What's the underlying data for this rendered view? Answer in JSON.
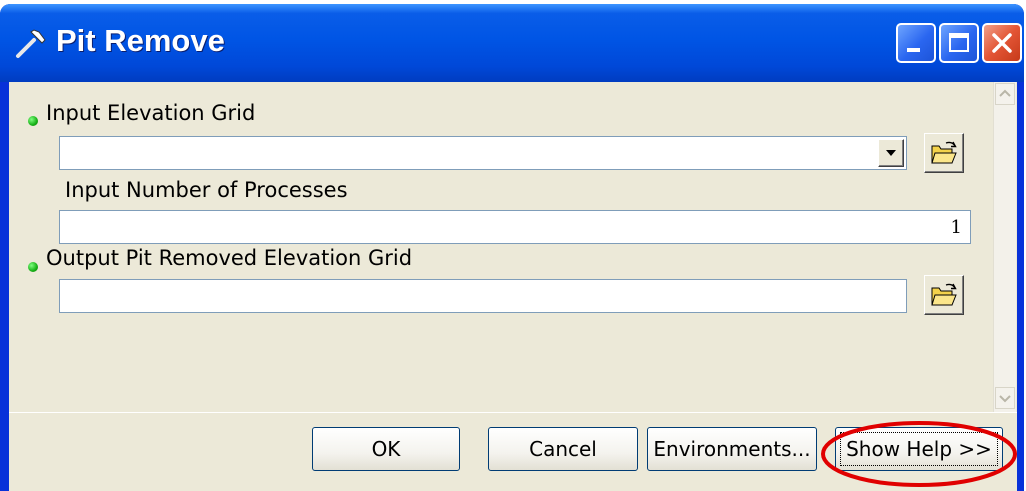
{
  "window": {
    "title": "Pit Remove",
    "icon": "hammer-icon",
    "controls": [
      "minimize-icon",
      "maximize-icon",
      "close-icon"
    ]
  },
  "form": {
    "input_elevation_grid": {
      "label": "Input Elevation Grid",
      "value": "",
      "required": true
    },
    "input_number_of_processes": {
      "label": "Input Number of Processes",
      "value": "1",
      "required": false
    },
    "output_pit_removed_grid": {
      "label": "Output Pit Removed Elevation Grid",
      "value": "",
      "required": true
    }
  },
  "buttons": {
    "ok": "OK",
    "cancel": "Cancel",
    "environments": "Environments...",
    "show_help": "Show Help >>"
  },
  "colors": {
    "title_bar": "#0055e5",
    "dialog_bg": "#ece9d8",
    "required_dot": "#16b016",
    "annotation": "#e00000"
  }
}
